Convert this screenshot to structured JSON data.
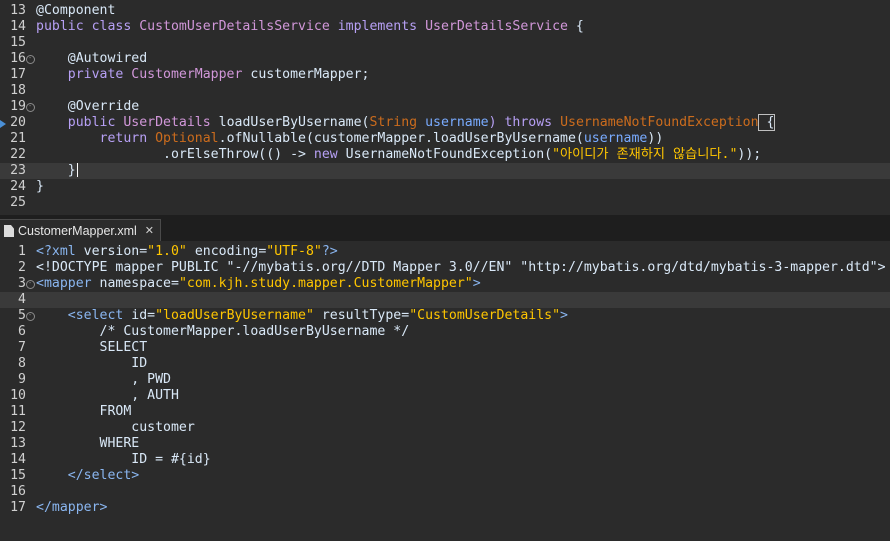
{
  "java_editor": {
    "lines": [
      {
        "num": "13",
        "tokens": [
          [
            "@Component",
            "ann"
          ]
        ]
      },
      {
        "num": "14",
        "tokens": [
          [
            "public ",
            "kw2"
          ],
          [
            "class ",
            "kw2"
          ],
          [
            "CustomUserDetailsService",
            "type"
          ],
          [
            " implements ",
            "kw2"
          ],
          [
            "UserDetailsService",
            "type"
          ],
          [
            " {",
            "plain"
          ]
        ]
      },
      {
        "num": "15",
        "tokens": []
      },
      {
        "num": "16",
        "fold": true,
        "tokens": [
          [
            "    @Autowired",
            "ann"
          ]
        ]
      },
      {
        "num": "17",
        "tokens": [
          [
            "    private ",
            "kw2"
          ],
          [
            "CustomerMapper",
            "type"
          ],
          [
            " customerMapper;",
            "plain"
          ]
        ]
      },
      {
        "num": "18",
        "tokens": []
      },
      {
        "num": "19",
        "fold": true,
        "tokens": [
          [
            "    @Override",
            "ann"
          ]
        ]
      },
      {
        "num": "20",
        "marker": true,
        "tokens": [
          [
            "    public ",
            "kw2"
          ],
          [
            "UserDetails",
            "type"
          ],
          [
            " loadUserByUsername(",
            "plain"
          ],
          [
            "String",
            "kw"
          ],
          [
            " username",
            "param"
          ],
          [
            ") throws ",
            "kw2"
          ],
          [
            "UsernameNotFoundException",
            "kw"
          ],
          [
            " {",
            "bracket"
          ]
        ]
      },
      {
        "num": "21",
        "tokens": [
          [
            "        return ",
            "kw2"
          ],
          [
            "Optional",
            "kw"
          ],
          [
            ".ofNullable(customerMapper.loadUserByUsername(",
            "plain"
          ],
          [
            "username",
            "param"
          ],
          [
            "))",
            "plain"
          ]
        ]
      },
      {
        "num": "22",
        "tokens": [
          [
            "                .orElseThrow(() -> ",
            "plain"
          ],
          [
            "new ",
            "kw2"
          ],
          [
            "UsernameNotFoundException(",
            "plain"
          ],
          [
            "\"아이디가 존재하지 않습니다.\"",
            "str"
          ],
          [
            "));",
            "plain"
          ]
        ]
      },
      {
        "num": "23",
        "current": true,
        "cursor": true,
        "tokens": [
          [
            "    }",
            "plain"
          ]
        ]
      },
      {
        "num": "24",
        "tokens": [
          [
            "}",
            "plain"
          ]
        ]
      },
      {
        "num": "25",
        "tokens": []
      }
    ]
  },
  "tab": {
    "label": "CustomerMapper.xml"
  },
  "xml_editor": {
    "lines": [
      {
        "num": "1",
        "tokens": [
          [
            "<?xml ",
            "tag"
          ],
          [
            "version=",
            "attr"
          ],
          [
            "\"1.0\"",
            "aval"
          ],
          [
            " encoding=",
            "attr"
          ],
          [
            "\"UTF-8\"",
            "aval"
          ],
          [
            "?>",
            "tag"
          ]
        ]
      },
      {
        "num": "2",
        "tokens": [
          [
            "<!DOCTYPE mapper PUBLIC \"-//mybatis.org//DTD Mapper 3.0//EN\" \"http://mybatis.org/dtd/mybatis-3-mapper.dtd\">",
            "plain"
          ]
        ]
      },
      {
        "num": "3",
        "fold": true,
        "tokens": [
          [
            "<mapper ",
            "tag"
          ],
          [
            "namespace=",
            "attr"
          ],
          [
            "\"com.kjh.study.mapper.CustomerMapper\"",
            "aval"
          ],
          [
            ">",
            "tag"
          ]
        ]
      },
      {
        "num": "4",
        "current": true,
        "tokens": []
      },
      {
        "num": "5",
        "fold": true,
        "tokens": [
          [
            "    <select ",
            "tag"
          ],
          [
            "id=",
            "attr"
          ],
          [
            "\"loadUserByUsername\"",
            "aval"
          ],
          [
            " resultType=",
            "attr"
          ],
          [
            "\"CustomUserDetails\"",
            "aval"
          ],
          [
            ">",
            "tag"
          ]
        ]
      },
      {
        "num": "6",
        "tokens": [
          [
            "        /* CustomerMapper.loadUserByUsername */",
            "comment"
          ]
        ]
      },
      {
        "num": "7",
        "tokens": [
          [
            "        SELECT",
            "plain"
          ]
        ]
      },
      {
        "num": "8",
        "tokens": [
          [
            "            ID",
            "plain"
          ]
        ]
      },
      {
        "num": "9",
        "tokens": [
          [
            "            , PWD",
            "plain"
          ]
        ]
      },
      {
        "num": "10",
        "tokens": [
          [
            "            , AUTH",
            "plain"
          ]
        ]
      },
      {
        "num": "11",
        "tokens": [
          [
            "        FROM",
            "plain"
          ]
        ]
      },
      {
        "num": "12",
        "tokens": [
          [
            "            customer",
            "plain"
          ]
        ]
      },
      {
        "num": "13",
        "tokens": [
          [
            "        WHERE",
            "plain"
          ]
        ]
      },
      {
        "num": "14",
        "tokens": [
          [
            "            ID = #{id}",
            "plain"
          ]
        ]
      },
      {
        "num": "15",
        "tokens": [
          [
            "    </select>",
            "tag"
          ]
        ]
      },
      {
        "num": "16",
        "tokens": []
      },
      {
        "num": "17",
        "tokens": [
          [
            "</mapper>",
            "tag"
          ]
        ]
      }
    ]
  },
  "icons": {
    "fold": "fold-collapse-icon",
    "marker": "override-marker-icon",
    "file": "xml-file-icon",
    "close": "close-icon"
  }
}
